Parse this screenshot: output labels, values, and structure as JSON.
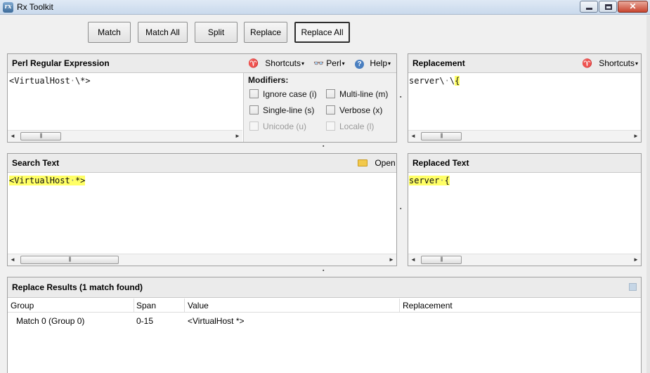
{
  "window": {
    "title": "Rx Toolkit"
  },
  "toolbar": {
    "buttons": [
      "Match",
      "Match All",
      "Split",
      "Replace",
      "Replace All"
    ]
  },
  "regex_pane": {
    "title": "Perl Regular Expression",
    "shortcuts": "Shortcuts",
    "perl": "Perl",
    "help": "Help",
    "expression": {
      "before": "<VirtualHost",
      "s1": "·",
      "mid1": "\\",
      "s2": "*>"
    },
    "modifiers_title": "Modifiers:",
    "modifiers": [
      {
        "label": "Ignore case (i)",
        "enabled": true,
        "checked": false
      },
      {
        "label": "Multi-line (m)",
        "enabled": true,
        "checked": false
      },
      {
        "label": "Single-line (s)",
        "enabled": true,
        "checked": false
      },
      {
        "label": "Verbose (x)",
        "enabled": true,
        "checked": false
      },
      {
        "label": "Unicode (u)",
        "enabled": false,
        "checked": false
      },
      {
        "label": "Locale (l)",
        "enabled": false,
        "checked": false
      }
    ]
  },
  "replacement_pane": {
    "title": "Replacement",
    "shortcuts": "Shortcuts",
    "text": {
      "a": "server",
      "b": "\\",
      "c": "·",
      "d": "\\",
      "e": "{"
    }
  },
  "search_pane": {
    "title": "Search Text",
    "open": "Open",
    "text": {
      "a": "<VirtualHost",
      "b": "·",
      "c": "*>"
    }
  },
  "replaced_pane": {
    "title": "Replaced Text",
    "text": {
      "a": "server",
      "b": "·",
      "c": "{"
    }
  },
  "results": {
    "title": "Replace Results (1 match found)",
    "columns": [
      "Group",
      "Span",
      "Value",
      "Replacement"
    ],
    "rows": [
      {
        "group": "Match 0 (Group 0)",
        "span": "0-15",
        "value": "<VirtualHost *>",
        "replacement": ""
      }
    ]
  },
  "colors": {
    "highlight": "#ffff66",
    "header": "#ebebeb"
  }
}
